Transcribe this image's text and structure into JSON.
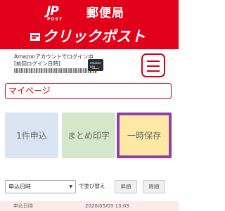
{
  "header": {
    "logo_mark": "JP",
    "logo_sub": "POST",
    "brand_name": "郵便局",
    "service_name": "クリックポスト",
    "colors": {
      "banner": "#e3001b",
      "text": "#ffffff"
    }
  },
  "account": {
    "line1": "Amazonアカウントでログイン中",
    "line2": "[前回ログイン日時]",
    "badge_line1": "amazon",
    "badge_line2": "pay"
  },
  "menu": {
    "icon": "hamburger-menu-icon"
  },
  "mypage": {
    "label": "マイページ"
  },
  "tiles": {
    "single": "1件申込",
    "bulk": "まとめ印字",
    "save": "一時保存"
  },
  "sort": {
    "selected": "申込日時",
    "label": "で並び替え",
    "asc": "昇順",
    "desc": "降順"
  },
  "table": {
    "row": {
      "label": "申込日時",
      "value": "2020/05/03 13:03"
    }
  }
}
